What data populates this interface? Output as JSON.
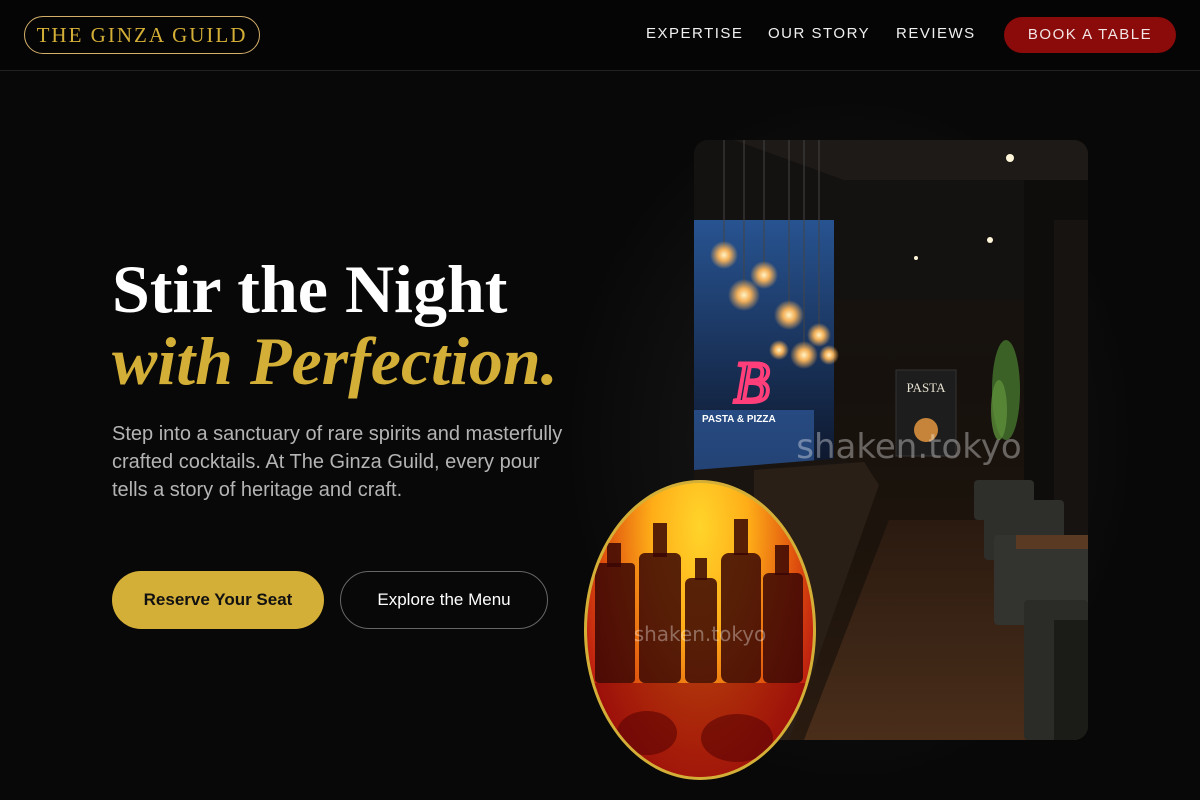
{
  "brand": {
    "name": "THE GINZA GUILD"
  },
  "nav": {
    "links": [
      {
        "label": "EXPERTISE"
      },
      {
        "label": "OUR STORY"
      },
      {
        "label": "REVIEWS"
      }
    ],
    "cta": "BOOK A TABLE"
  },
  "hero": {
    "title_line1": "Stir the Night",
    "title_line2": "with Perfection.",
    "description": "Step into a sanctuary of rare spirits and masterfully crafted cocktails. At The Ginza Guild, every pour tells a story of heritage and craft.",
    "primary_button": "Reserve Your Seat",
    "secondary_button": "Explore the Menu"
  },
  "images": {
    "main_watermark": "shaken.tokyo",
    "main_poster": "PASTA",
    "main_sign": "PASTA & PIZZA",
    "oval_watermark": "shaken.tokyo"
  },
  "colors": {
    "accent_gold": "#d4af37",
    "cta_red": "#8b0a0a",
    "background": "#080808"
  },
  "icons": {
    "pendant_lights": "pendant-lamp-icon",
    "neon_sign": "neon-b-icon"
  }
}
